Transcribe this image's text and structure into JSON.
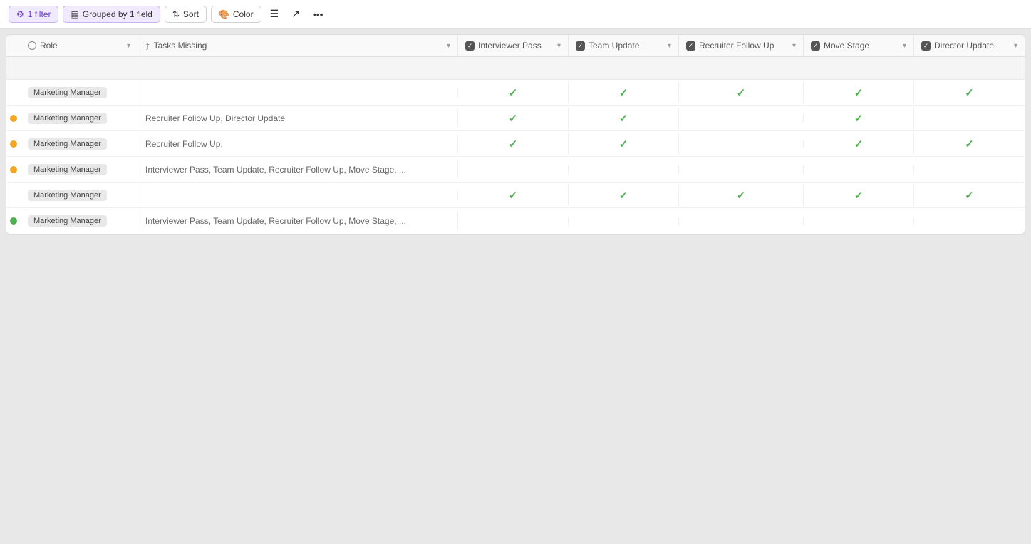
{
  "toolbar": {
    "filter_label": "1 filter",
    "group_label": "Grouped by 1 field",
    "sort_label": "Sort",
    "color_label": "Color",
    "row_height_label": "",
    "share_label": "",
    "more_label": "..."
  },
  "columns": [
    {
      "id": "role",
      "label": "Role",
      "icon": "circle-icon"
    },
    {
      "id": "tasks",
      "label": "Tasks Missing",
      "icon": "formula-icon"
    },
    {
      "id": "interviewer",
      "label": "Interviewer Pass",
      "icon": "checkbox-icon"
    },
    {
      "id": "team",
      "label": "Team Update",
      "icon": "checkbox-icon"
    },
    {
      "id": "recruiter",
      "label": "Recruiter Follow Up",
      "icon": "checkbox-icon"
    },
    {
      "id": "move",
      "label": "Move Stage",
      "icon": "checkbox-icon"
    },
    {
      "id": "director",
      "label": "Director Update",
      "icon": "checkbox-icon"
    }
  ],
  "rows": [
    {
      "dot": "none",
      "role": "Marketing Manager",
      "tasks": "",
      "interviewer": true,
      "team": true,
      "recruiter": true,
      "move": true,
      "director": true
    },
    {
      "dot": "yellow",
      "role": "Marketing Manager",
      "tasks": "Recruiter Follow Up, Director Update",
      "interviewer": true,
      "team": true,
      "recruiter": false,
      "move": true,
      "director": false
    },
    {
      "dot": "yellow",
      "role": "Marketing Manager",
      "tasks": "Recruiter Follow Up,",
      "interviewer": true,
      "team": true,
      "recruiter": false,
      "move": true,
      "director": true
    },
    {
      "dot": "yellow",
      "role": "Marketing Manager",
      "tasks": "Interviewer Pass, Team Update, Recruiter Follow Up, Move Stage, ...",
      "interviewer": false,
      "team": false,
      "recruiter": false,
      "move": false,
      "director": false
    },
    {
      "dot": "none",
      "role": "Marketing Manager",
      "tasks": "",
      "interviewer": true,
      "team": true,
      "recruiter": true,
      "move": true,
      "director": true
    },
    {
      "dot": "green",
      "role": "Marketing Manager",
      "tasks": "Interviewer Pass, Team Update, Recruiter Follow Up, Move Stage, ...",
      "interviewer": false,
      "team": false,
      "recruiter": false,
      "move": false,
      "director": false
    }
  ]
}
